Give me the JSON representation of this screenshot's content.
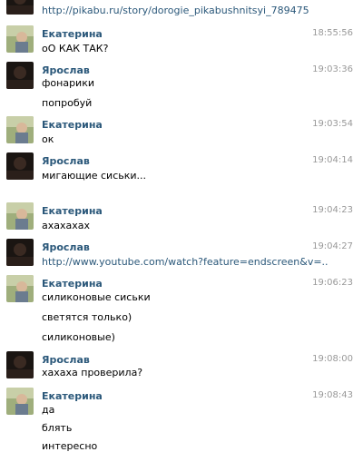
{
  "top_link": "http://pikabu.ru/story/dorogie_pikabushnitsyi_789475",
  "colors": {
    "name": "#2b587a",
    "link": "#2b587a",
    "time": "#999999",
    "text": "#000000"
  },
  "messages": [
    {
      "author": "Екатерина",
      "avatar": "ekaterina-avatar",
      "time": "18:55:56",
      "lines": [
        "оО КАК ТАК?"
      ]
    },
    {
      "author": "Ярослав",
      "avatar": "yaroslav-avatar",
      "time": "19:03:36",
      "lines": [
        "фонарики",
        "попробуй"
      ]
    },
    {
      "author": "Екатерина",
      "avatar": "ekaterina-avatar",
      "time": "19:03:54",
      "lines": [
        "ок"
      ]
    },
    {
      "author": "Ярослав",
      "avatar": "yaroslav-avatar",
      "time": "19:04:14",
      "lines": [
        "мигающие сиськи..."
      ]
    },
    {
      "author": "Екатерина",
      "avatar": "ekaterina-avatar",
      "time": "19:04:23",
      "lines": [
        "ахахахах"
      ]
    },
    {
      "author": "Ярослав",
      "avatar": "yaroslav-avatar",
      "time": "19:04:27",
      "lines": [
        "http://www.youtube.com/watch?feature=endscreen&v=.."
      ]
    },
    {
      "author": "Екатерина",
      "avatar": "ekaterina-avatar",
      "time": "19:06:23",
      "lines": [
        "силиконовые сиськи",
        "светятся только)",
        "силиконовые)"
      ]
    },
    {
      "author": "Ярослав",
      "avatar": "yaroslav-avatar",
      "time": "19:08:00",
      "lines": [
        "хахаха проверила?"
      ]
    },
    {
      "author": "Екатерина",
      "avatar": "ekaterina-avatar",
      "time": "19:08:43",
      "lines": [
        "да",
        "блять",
        "интересно"
      ]
    }
  ]
}
